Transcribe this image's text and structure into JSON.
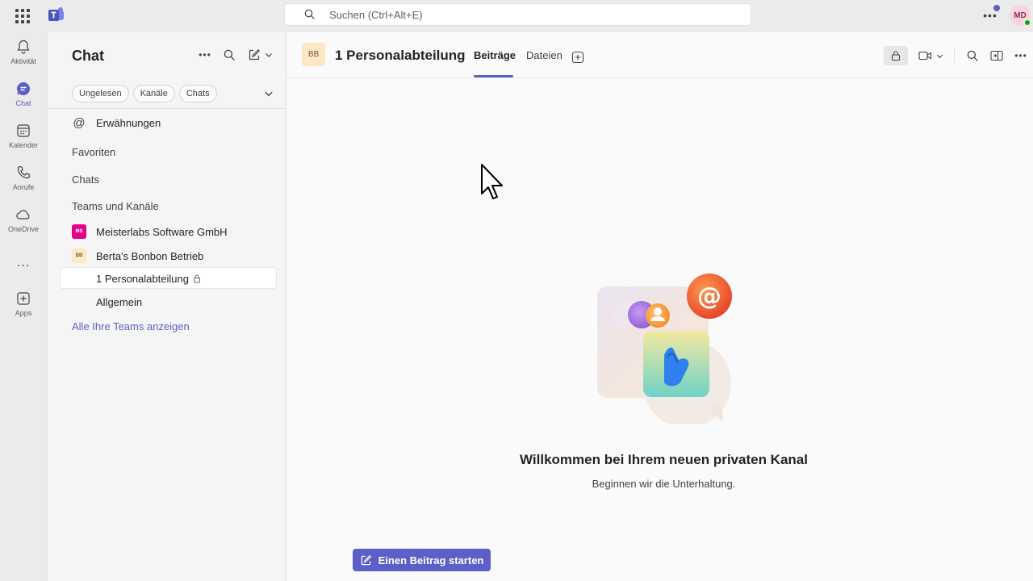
{
  "search": {
    "placeholder": "Suchen (Ctrl+Alt+E)"
  },
  "user": {
    "initials": "MD"
  },
  "rail": {
    "items": [
      {
        "label": "Aktivität",
        "icon": "bell-icon"
      },
      {
        "label": "Chat",
        "icon": "chat-icon"
      },
      {
        "label": "Kalender",
        "icon": "calendar-icon"
      },
      {
        "label": "Anrufe",
        "icon": "phone-icon"
      },
      {
        "label": "OneDrive",
        "icon": "cloud-icon"
      },
      {
        "label": "...",
        "icon": "more-icon"
      },
      {
        "label": "Apps",
        "icon": "apps-add-icon"
      }
    ]
  },
  "leftpanel": {
    "title": "Chat",
    "filters": [
      "Ungelesen",
      "Kanäle",
      "Chats"
    ],
    "mentions": "Erwähnungen",
    "favorites": "Favoriten",
    "chats": "Chats",
    "teams_section": "Teams und Kanäle",
    "teams": [
      {
        "initials": "MS",
        "name": "Meisterlabs Software GmbH",
        "color": "#e3008c",
        "text_color": "#ffffff"
      },
      {
        "initials": "BB",
        "name": "Berta's Bonbon Betrieb",
        "color": "#fde7c5",
        "text_color": "#7a5b2a"
      }
    ],
    "channels": [
      "1 Personalabteilung",
      "Allgemein"
    ],
    "show_all": "Alle Ihre Teams anzeigen"
  },
  "header": {
    "tile": "BB",
    "channel_name": "1 Personalabteilung",
    "tabs": [
      "Beiträge",
      "Dateien"
    ]
  },
  "welcome": {
    "title": "Willkommen bei Ihrem neuen privaten Kanal",
    "subtitle": "Beginnen wir die Unterhaltung."
  },
  "start_post": {
    "label": "Einen Beitrag starten"
  },
  "colors": {
    "brand": "#5b5fc7",
    "rail_bg": "#ebebeb",
    "panel_bg": "#f5f5f5"
  }
}
